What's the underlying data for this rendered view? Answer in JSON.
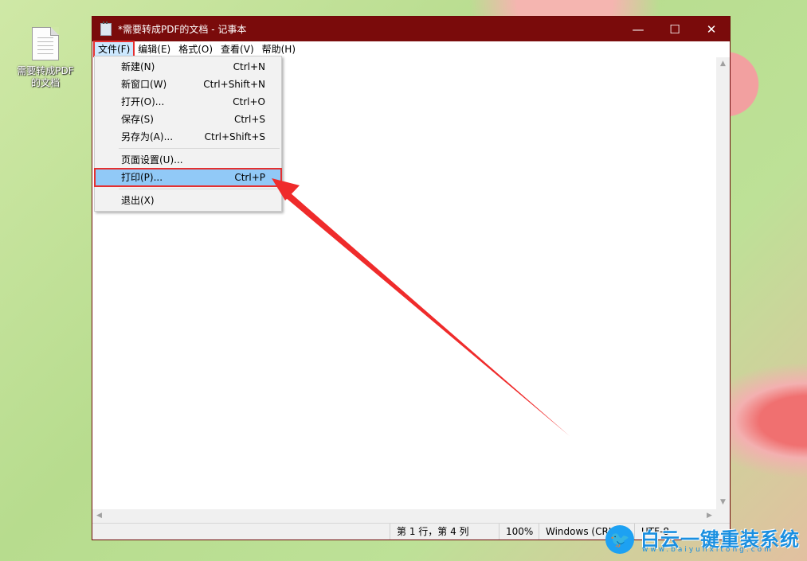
{
  "desktop": {
    "icon_label_line1": "需要转成PDF",
    "icon_label_line2": "的文档"
  },
  "window": {
    "title": "*需要转成PDF的文档 - 记事本",
    "minimize_glyph": "—",
    "maximize_glyph": "☐",
    "close_glyph": "✕"
  },
  "menubar": {
    "items": [
      {
        "label": "文件(F)"
      },
      {
        "label": "编辑(E)"
      },
      {
        "label": "格式(O)"
      },
      {
        "label": "查看(V)"
      },
      {
        "label": "帮助(H)"
      }
    ]
  },
  "file_menu": {
    "items": [
      {
        "label": "新建(N)",
        "shortcut": "Ctrl+N"
      },
      {
        "label": "新窗口(W)",
        "shortcut": "Ctrl+Shift+N"
      },
      {
        "label": "打开(O)...",
        "shortcut": "Ctrl+O"
      },
      {
        "label": "保存(S)",
        "shortcut": "Ctrl+S"
      },
      {
        "label": "另存为(A)...",
        "shortcut": "Ctrl+Shift+S"
      },
      {
        "label": "页面设置(U)...",
        "shortcut": ""
      },
      {
        "label": "打印(P)...",
        "shortcut": "Ctrl+P"
      },
      {
        "label": "退出(X)",
        "shortcut": ""
      }
    ]
  },
  "statusbar": {
    "position": "第 1 行，第 4 列",
    "zoom": "100%",
    "line_ending": "Windows (CRLF)",
    "encoding": "UTF-8"
  },
  "watermark": {
    "text": "白云一键重装系统",
    "url": "www.baiyunxitong.com"
  },
  "colors": {
    "titlebar": "#7a0b0b",
    "highlight_box": "#e53030",
    "menu_highlight": "#91c9f7"
  }
}
